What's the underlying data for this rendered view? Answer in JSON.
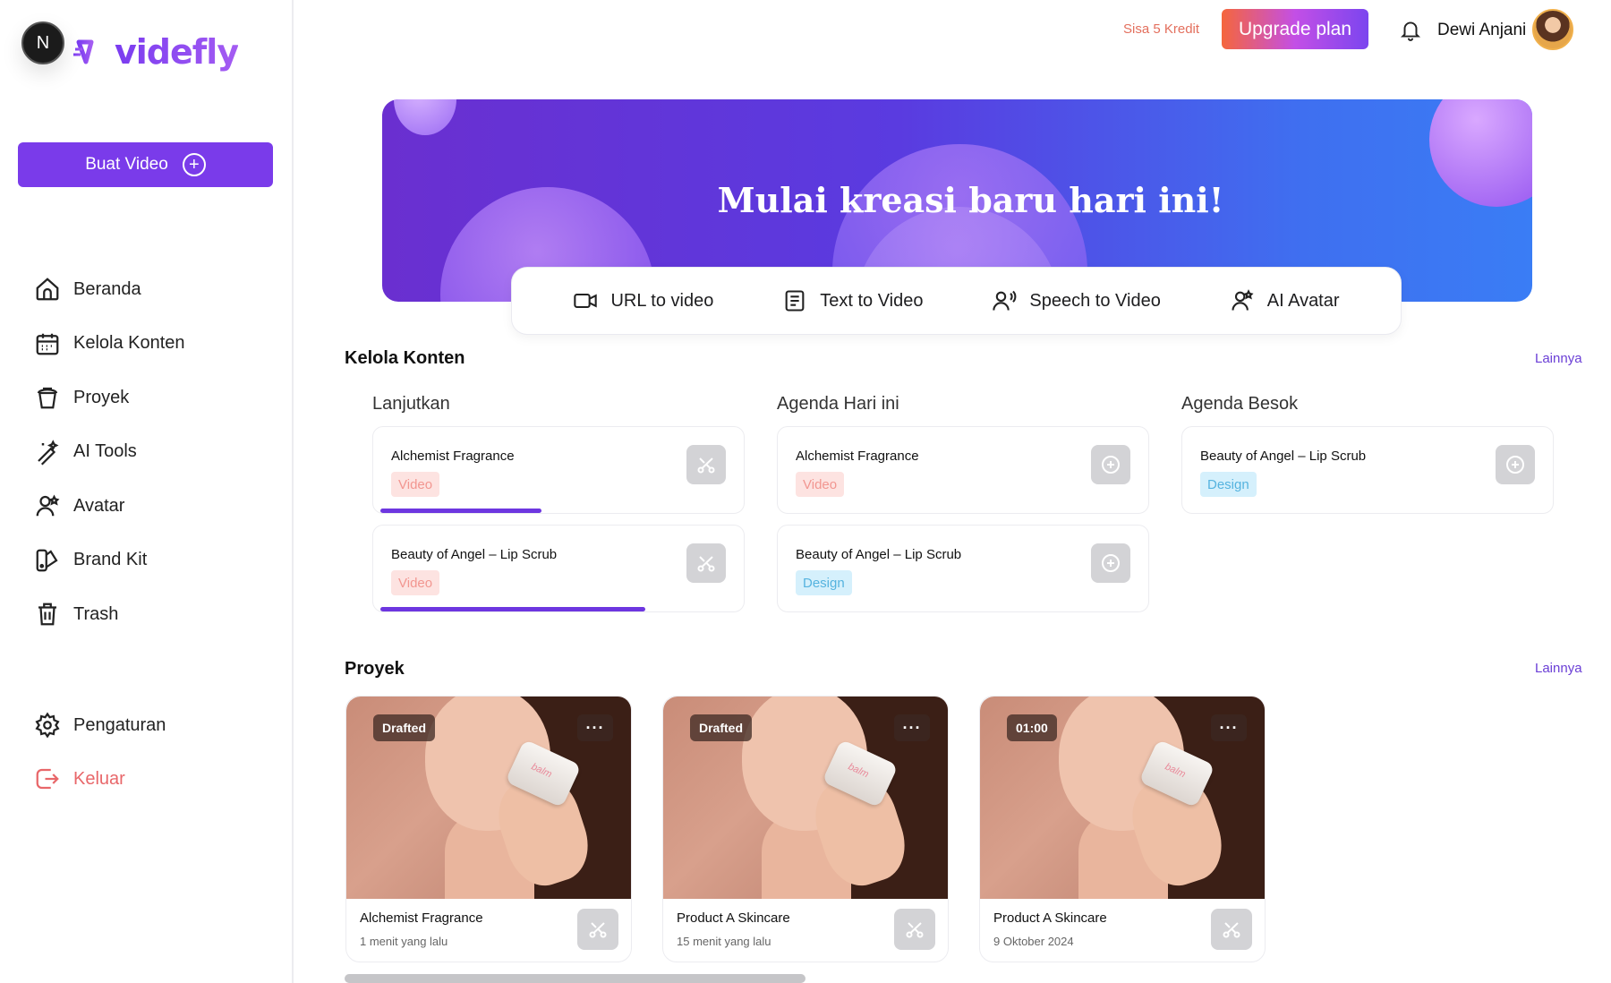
{
  "brand": {
    "avatar_initial": "N",
    "logo_text": "videfly"
  },
  "sidebar": {
    "create_label": "Buat Video",
    "items": [
      {
        "label": "Beranda",
        "icon": "home-icon"
      },
      {
        "label": "Kelola Konten",
        "icon": "calendar-icon"
      },
      {
        "label": "Proyek",
        "icon": "project-icon"
      },
      {
        "label": "AI Tools",
        "icon": "magic-wand-icon"
      },
      {
        "label": "Avatar",
        "icon": "avatar-icon"
      },
      {
        "label": "Brand Kit",
        "icon": "brand-kit-icon"
      },
      {
        "label": "Trash",
        "icon": "trash-icon"
      }
    ],
    "settings_label": "Pengaturan",
    "logout_label": "Keluar"
  },
  "header": {
    "credits": "Sisa 5 Kredit",
    "upgrade_label": "Upgrade plan",
    "user_name": "Dewi Anjani"
  },
  "banner": {
    "title": "Mulai kreasi baru hari ini!",
    "modes": [
      {
        "label": "URL to video",
        "icon": "video-camera-icon"
      },
      {
        "label": "Text to Video",
        "icon": "document-icon"
      },
      {
        "label": "Speech to Video",
        "icon": "speech-icon"
      },
      {
        "label": "AI Avatar",
        "icon": "ai-avatar-icon"
      }
    ]
  },
  "kelola": {
    "title": "Kelola Konten",
    "more_label": "Lainnya",
    "columns": [
      {
        "title": "Lanjutkan",
        "cards": [
          {
            "name": "Alchemist Fragrance",
            "tag": "Video",
            "progress": 0.43
          },
          {
            "name": "Beauty of Angel – Lip Scrub",
            "tag": "Video",
            "progress": 0.71
          }
        ]
      },
      {
        "title": "Agenda Hari ini",
        "cards": [
          {
            "name": "Alchemist Fragrance",
            "tag": "Video"
          },
          {
            "name": "Beauty of Angel – Lip Scrub",
            "tag": "Design"
          }
        ]
      },
      {
        "title": "Agenda Besok",
        "cards": [
          {
            "name": "Beauty of Angel – Lip Scrub",
            "tag": "Design"
          }
        ]
      }
    ]
  },
  "proyek": {
    "title": "Proyek",
    "more_label": "Lainnya",
    "items": [
      {
        "badge": "Drafted",
        "menu": "···",
        "name": "Alchemist Fragrance",
        "time": "1 menit yang lalu",
        "jar_label": "balm"
      },
      {
        "badge": "Drafted",
        "menu": "···",
        "name": "Product A Skincare",
        "time": "15 menit yang lalu",
        "jar_label": "balm"
      },
      {
        "badge": "01:00",
        "menu": "···",
        "name": "Product A Skincare",
        "time": "9 Oktober 2024",
        "jar_label": "balm"
      }
    ]
  },
  "colors": {
    "accent": "#7a3bea",
    "logout": "#e8676a",
    "credits": "#e36f5d",
    "link": "#6b3fd6"
  }
}
